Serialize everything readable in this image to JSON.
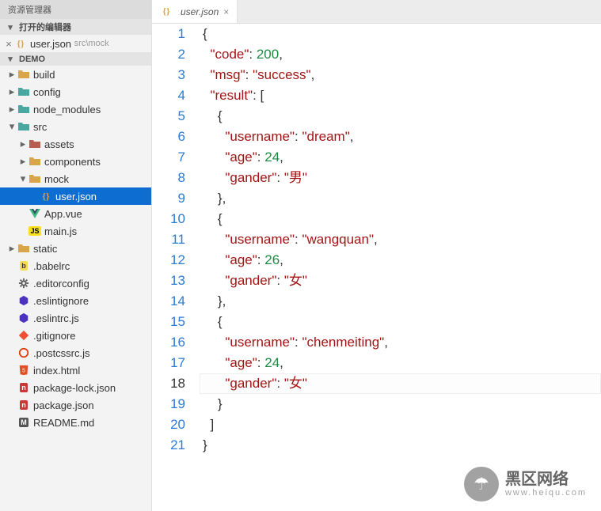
{
  "sidebar": {
    "title": "资源管理器",
    "openEditorsHeader": "打开的编辑器",
    "openEditors": [
      {
        "icon": "json-icon",
        "name": "user.json",
        "path": "src\\mock"
      }
    ],
    "projectHeader": "DEMO",
    "tree": [
      {
        "depth": 0,
        "twisty": "▸",
        "icon": "folder-yellow",
        "label": "build"
      },
      {
        "depth": 0,
        "twisty": "▸",
        "icon": "folder-teal",
        "label": "config"
      },
      {
        "depth": 0,
        "twisty": "▸",
        "icon": "folder-teal",
        "label": "node_modules"
      },
      {
        "depth": 0,
        "twisty": "▾",
        "icon": "folder-teal",
        "label": "src"
      },
      {
        "depth": 1,
        "twisty": "▸",
        "icon": "folder-red",
        "label": "assets"
      },
      {
        "depth": 1,
        "twisty": "▸",
        "icon": "folder-yellow",
        "label": "components"
      },
      {
        "depth": 1,
        "twisty": "▾",
        "icon": "folder-yellow",
        "label": "mock"
      },
      {
        "depth": 2,
        "twisty": "",
        "icon": "json-icon",
        "label": "user.json",
        "selected": true
      },
      {
        "depth": 1,
        "twisty": "",
        "icon": "vue-icon",
        "label": "App.vue"
      },
      {
        "depth": 1,
        "twisty": "",
        "icon": "js-icon",
        "label": "main.js"
      },
      {
        "depth": 0,
        "twisty": "▸",
        "icon": "folder-yellow",
        "label": "static"
      },
      {
        "depth": 0,
        "twisty": "",
        "icon": "babel-icon",
        "label": ".babelrc"
      },
      {
        "depth": 0,
        "twisty": "",
        "icon": "gear-icon",
        "label": ".editorconfig"
      },
      {
        "depth": 0,
        "twisty": "",
        "icon": "eslint-icon",
        "label": ".eslintignore"
      },
      {
        "depth": 0,
        "twisty": "",
        "icon": "eslint-icon",
        "label": ".eslintrc.js"
      },
      {
        "depth": 0,
        "twisty": "",
        "icon": "git-icon",
        "label": ".gitignore"
      },
      {
        "depth": 0,
        "twisty": "",
        "icon": "postcss-icon",
        "label": ".postcssrc.js"
      },
      {
        "depth": 0,
        "twisty": "",
        "icon": "html-icon",
        "label": "index.html"
      },
      {
        "depth": 0,
        "twisty": "",
        "icon": "npm-icon",
        "label": "package-lock.json"
      },
      {
        "depth": 0,
        "twisty": "",
        "icon": "npm-icon",
        "label": "package.json"
      },
      {
        "depth": 0,
        "twisty": "",
        "icon": "md-icon",
        "label": "README.md"
      }
    ]
  },
  "tab": {
    "icon": "json-icon",
    "title": "user.json"
  },
  "code": {
    "currentLine": 18,
    "lines": [
      {
        "n": 1,
        "tokens": [
          {
            "t": "{",
            "c": "p"
          }
        ]
      },
      {
        "n": 2,
        "tokens": [
          {
            "t": "  ",
            "c": "sp"
          },
          {
            "t": "\"code\"",
            "c": "key"
          },
          {
            "t": ": ",
            "c": "p"
          },
          {
            "t": "200",
            "c": "num"
          },
          {
            "t": ",",
            "c": "p"
          }
        ]
      },
      {
        "n": 3,
        "tokens": [
          {
            "t": "  ",
            "c": "sp"
          },
          {
            "t": "\"msg\"",
            "c": "key"
          },
          {
            "t": ": ",
            "c": "p"
          },
          {
            "t": "\"success\"",
            "c": "str"
          },
          {
            "t": ",",
            "c": "p"
          }
        ]
      },
      {
        "n": 4,
        "tokens": [
          {
            "t": "  ",
            "c": "sp"
          },
          {
            "t": "\"result\"",
            "c": "key"
          },
          {
            "t": ": [",
            "c": "p"
          }
        ]
      },
      {
        "n": 5,
        "tokens": [
          {
            "t": "    ",
            "c": "sp"
          },
          {
            "t": "{",
            "c": "p"
          }
        ]
      },
      {
        "n": 6,
        "tokens": [
          {
            "t": "      ",
            "c": "sp"
          },
          {
            "t": "\"username\"",
            "c": "key"
          },
          {
            "t": ": ",
            "c": "p"
          },
          {
            "t": "\"dream\"",
            "c": "str"
          },
          {
            "t": ",",
            "c": "p"
          }
        ]
      },
      {
        "n": 7,
        "tokens": [
          {
            "t": "      ",
            "c": "sp"
          },
          {
            "t": "\"age\"",
            "c": "key"
          },
          {
            "t": ": ",
            "c": "p"
          },
          {
            "t": "24",
            "c": "num"
          },
          {
            "t": ",",
            "c": "p"
          }
        ]
      },
      {
        "n": 8,
        "tokens": [
          {
            "t": "      ",
            "c": "sp"
          },
          {
            "t": "\"gander\"",
            "c": "key"
          },
          {
            "t": ": ",
            "c": "p"
          },
          {
            "t": "\"男\"",
            "c": "str"
          }
        ]
      },
      {
        "n": 9,
        "tokens": [
          {
            "t": "    ",
            "c": "sp"
          },
          {
            "t": "},",
            "c": "p"
          }
        ]
      },
      {
        "n": 10,
        "tokens": [
          {
            "t": "    ",
            "c": "sp"
          },
          {
            "t": "{",
            "c": "p"
          }
        ]
      },
      {
        "n": 11,
        "tokens": [
          {
            "t": "      ",
            "c": "sp"
          },
          {
            "t": "\"username\"",
            "c": "key"
          },
          {
            "t": ": ",
            "c": "p"
          },
          {
            "t": "\"wangquan\"",
            "c": "str"
          },
          {
            "t": ",",
            "c": "p"
          }
        ]
      },
      {
        "n": 12,
        "tokens": [
          {
            "t": "      ",
            "c": "sp"
          },
          {
            "t": "\"age\"",
            "c": "key"
          },
          {
            "t": ": ",
            "c": "p"
          },
          {
            "t": "26",
            "c": "num"
          },
          {
            "t": ",",
            "c": "p"
          }
        ]
      },
      {
        "n": 13,
        "tokens": [
          {
            "t": "      ",
            "c": "sp"
          },
          {
            "t": "\"gander\"",
            "c": "key"
          },
          {
            "t": ": ",
            "c": "p"
          },
          {
            "t": "\"女\"",
            "c": "str"
          }
        ]
      },
      {
        "n": 14,
        "tokens": [
          {
            "t": "    ",
            "c": "sp"
          },
          {
            "t": "},",
            "c": "p"
          }
        ]
      },
      {
        "n": 15,
        "tokens": [
          {
            "t": "    ",
            "c": "sp"
          },
          {
            "t": "{",
            "c": "p"
          }
        ]
      },
      {
        "n": 16,
        "tokens": [
          {
            "t": "      ",
            "c": "sp"
          },
          {
            "t": "\"username\"",
            "c": "key"
          },
          {
            "t": ": ",
            "c": "p"
          },
          {
            "t": "\"chenmeiting\"",
            "c": "str"
          },
          {
            "t": ",",
            "c": "p"
          }
        ]
      },
      {
        "n": 17,
        "tokens": [
          {
            "t": "      ",
            "c": "sp"
          },
          {
            "t": "\"age\"",
            "c": "key"
          },
          {
            "t": ": ",
            "c": "p"
          },
          {
            "t": "24",
            "c": "num"
          },
          {
            "t": ",",
            "c": "p"
          }
        ]
      },
      {
        "n": 18,
        "tokens": [
          {
            "t": "      ",
            "c": "sp"
          },
          {
            "t": "\"gander\"",
            "c": "key"
          },
          {
            "t": ": ",
            "c": "p"
          },
          {
            "t": "\"女\"",
            "c": "str"
          }
        ]
      },
      {
        "n": 19,
        "tokens": [
          {
            "t": "    ",
            "c": "sp"
          },
          {
            "t": "}",
            "c": "p"
          }
        ]
      },
      {
        "n": 20,
        "tokens": [
          {
            "t": "  ",
            "c": "sp"
          },
          {
            "t": "]",
            "c": "p"
          }
        ]
      },
      {
        "n": 21,
        "tokens": [
          {
            "t": "}",
            "c": "p"
          }
        ]
      }
    ]
  },
  "watermark": {
    "big": "黑区网络",
    "small": "www.heiqu.com",
    "glyph": "☂"
  },
  "icons": {
    "folder-yellow": {
      "type": "folder",
      "fill": "#d9a54a"
    },
    "folder-teal": {
      "type": "folder",
      "fill": "#4aa7a0"
    },
    "folder-red": {
      "type": "folder",
      "fill": "#b85b50"
    },
    "json-icon": {
      "type": "braces",
      "fill": "#d9a54a"
    },
    "vue-icon": {
      "type": "vue"
    },
    "js-icon": {
      "type": "badge",
      "bg": "#f7df1e",
      "fg": "#000",
      "txt": "JS"
    },
    "babel-icon": {
      "type": "badge",
      "bg": "#f5da55",
      "fg": "#333",
      "txt": "b"
    },
    "gear-icon": {
      "type": "gear",
      "fill": "#555"
    },
    "eslint-icon": {
      "type": "hex",
      "fill": "#4b32c3"
    },
    "git-icon": {
      "type": "diamond",
      "fill": "#f05033"
    },
    "postcss-icon": {
      "type": "circle",
      "fill": "#dd3a0a"
    },
    "html-icon": {
      "type": "shield",
      "fill": "#e44d26",
      "txt": "5"
    },
    "npm-icon": {
      "type": "badge",
      "bg": "#cb3837",
      "fg": "#fff",
      "txt": "n"
    },
    "md-icon": {
      "type": "badge",
      "bg": "#555",
      "fg": "#fff",
      "txt": "M"
    }
  }
}
